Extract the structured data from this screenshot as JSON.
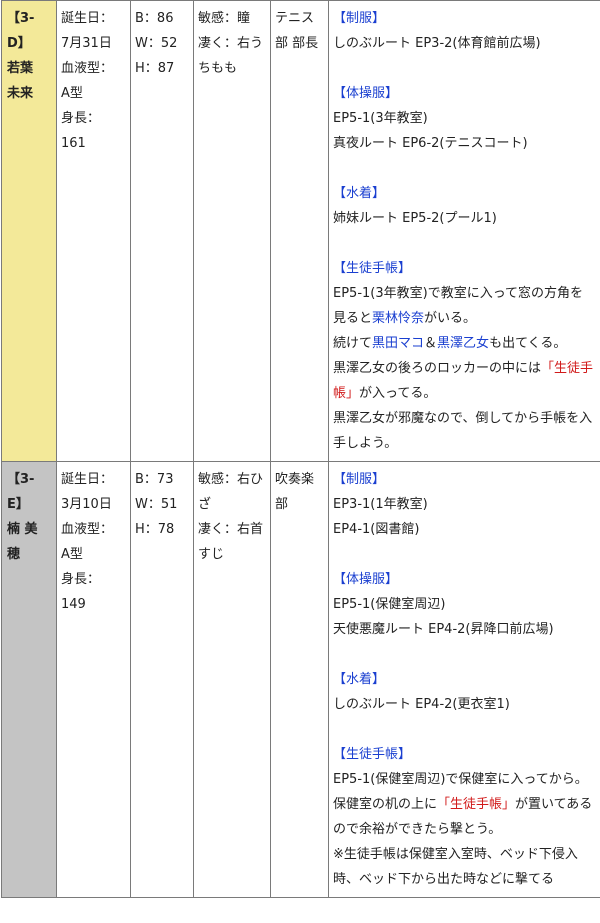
{
  "rows": [
    {
      "name_lines": [
        "【3-",
        "D】",
        "若葉",
        "未来"
      ],
      "profile": [
        "誕生日：",
        "7月31日",
        "血液型：",
        "A型",
        "身長：",
        "161"
      ],
      "size": [
        "B：86",
        "W：52",
        "H：87"
      ],
      "sense": [
        "敏感：瞳",
        "凄く：右うちもも"
      ],
      "club": "テニス部 部長",
      "sections": [
        {
          "heading": "【制服】",
          "lines": [
            "しのぶルート EP3-2(体育館前広場)"
          ]
        },
        {
          "heading": "【体操服】",
          "lines": [
            "EP5-1(3年教室)",
            "真夜ルート EP6-2(テニスコート)"
          ]
        },
        {
          "heading": "【水着】",
          "lines": [
            "姉妹ルート EP5-2(プール1)"
          ]
        },
        {
          "heading": "【生徒手帳】",
          "lines": []
        }
      ],
      "techo": {
        "p1": "EP5-1(3年教室)で教室に入って窓の方角を見ると",
        "p1_link": "栗林怜奈",
        "p1_end": "がいる。",
        "p2_start": "続けて",
        "p2_link1": "黒田マコ",
        "p2_mid": "＆",
        "p2_link2": "黒澤乙女",
        "p2_end": "も出てくる。",
        "p3_start": "黒澤乙女の後ろのロッカーの中には",
        "p3_red": "「生徒手帳」",
        "p3_end": "が入ってる。",
        "p4": "黒澤乙女が邪魔なので、倒してから手帳を入手しよう。"
      }
    },
    {
      "name_lines": [
        "【3-",
        "E】",
        "楠 美",
        "穂"
      ],
      "profile": [
        "誕生日：",
        "3月10日",
        "血液型：",
        "A型",
        "身長：",
        "149"
      ],
      "size": [
        "B：73",
        "W：51",
        "H：78"
      ],
      "sense": [
        "敏感：右ひざ",
        "凄く：右首すじ"
      ],
      "club": "吹奏楽部",
      "sections": [
        {
          "heading": "【制服】",
          "lines": [
            "EP3-1(1年教室)",
            "EP4-1(図書館)"
          ]
        },
        {
          "heading": "【体操服】",
          "lines": [
            "EP5-1(保健室周辺)",
            "天使悪魔ルート EP4-2(昇降口前広場)"
          ]
        },
        {
          "heading": "【水着】",
          "lines": [
            "しのぶルート EP4-2(更衣室1)"
          ]
        },
        {
          "heading": "【生徒手帳】",
          "lines": []
        }
      ],
      "techo": {
        "p1": "EP5-1(保健室周辺)で保健室に入ってから。",
        "p2_start": "保健室の机の上に",
        "p2_red": "「生徒手帳」",
        "p2_end": "が置いてあるので余裕ができたら撃とう。",
        "p3": "※生徒手帳は保健室入室時、ベッド下侵入時、ベッド下から出た時などに撃てる"
      }
    }
  ]
}
